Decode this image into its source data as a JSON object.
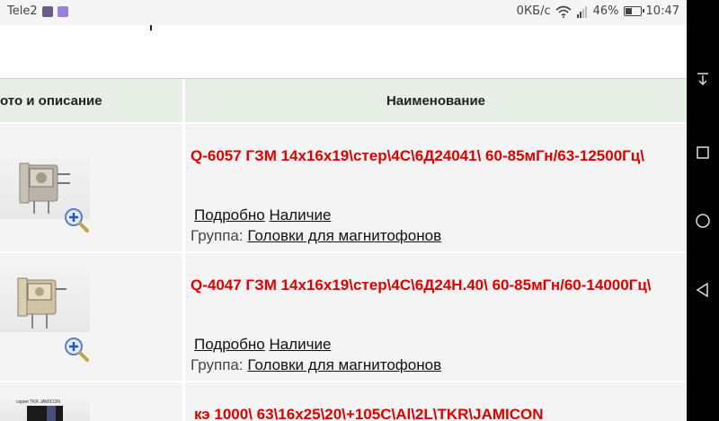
{
  "status": {
    "carrier": "Tele2",
    "data_speed": "0КБ/с",
    "battery": "46%",
    "battery_level": 0.46,
    "time": "10:47"
  },
  "table": {
    "headers": [
      "ото и описание",
      "Наименование"
    ]
  },
  "rows": [
    {
      "title": "Q-6057 ГЗМ 14х16х19\\стер\\4С\\6Д24041\\ 60-85мГн/63-12500Гц\\",
      "details_link": "Подробно",
      "availability_link": "Наличие",
      "group_label": "Группа:",
      "group_link": "Головки для магнитофонов"
    },
    {
      "title": "Q-4047 ГЗМ 14х16х19\\стер\\4С\\6Д24Н.40\\ 60-85мГн/60-14000Гц\\",
      "details_link": "Подробно",
      "availability_link": "Наличие",
      "group_label": "Группа:",
      "group_link": "Головки для магнитофонов"
    },
    {
      "title": "кэ 1000\\ 63\\16х25\\20\\+105С\\Al\\2L\\TKR\\JAMICON",
      "thumb_text": "серия TKR JAMICON"
    }
  ]
}
